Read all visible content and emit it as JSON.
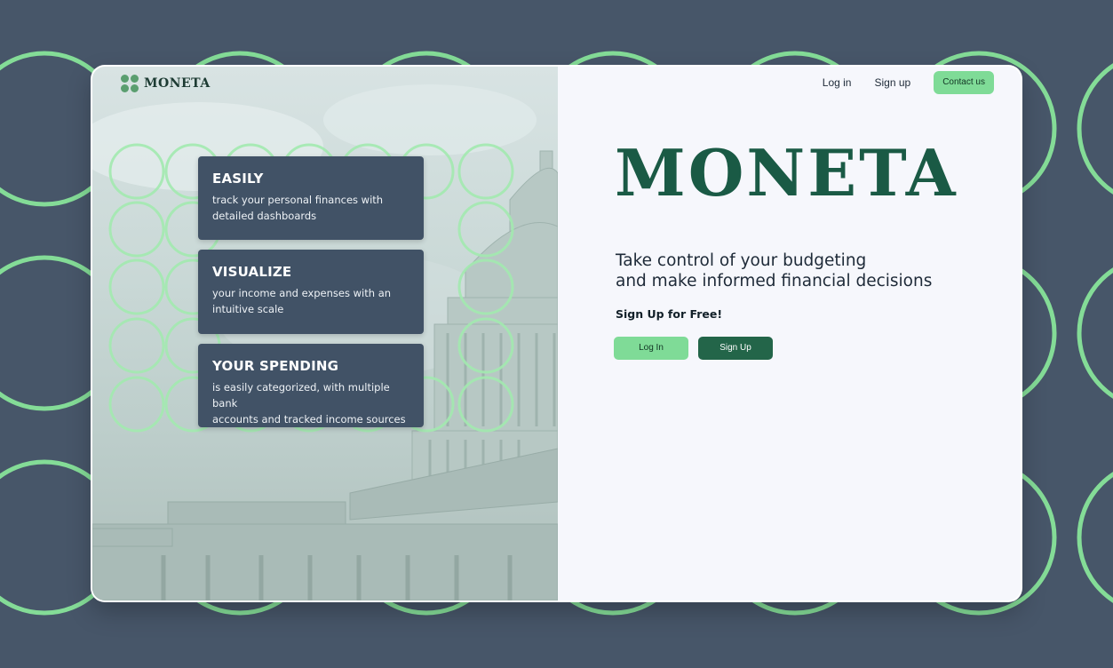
{
  "brand": {
    "logo_text": "MONETA",
    "hero_title": "MONETA"
  },
  "nav": {
    "login": "Log in",
    "signup": "Sign up",
    "contact": "Contact us"
  },
  "features": [
    {
      "title": "EASILY",
      "line1": "track your personal finances with",
      "line2": "detailed dashboards"
    },
    {
      "title": "VISUALIZE",
      "line1": "your income and expenses with an",
      "line2": "intuitive scale"
    },
    {
      "title": "YOUR SPENDING",
      "line1": "is easily categorized, with multiple bank",
      "line2": "accounts and tracked income sources"
    }
  ],
  "hero": {
    "subtitle_line1": "Take control of your budgeting",
    "subtitle_line2": "and make informed financial decisions",
    "free_label": "Sign Up for Free!",
    "login_button": "Log In",
    "signup_button": "Sign Up"
  },
  "colors": {
    "page_background": "#475669",
    "accent_green": "#7fdb97",
    "dark_green": "#236549",
    "card_background": "#415266",
    "title_green": "#1a5a45"
  }
}
